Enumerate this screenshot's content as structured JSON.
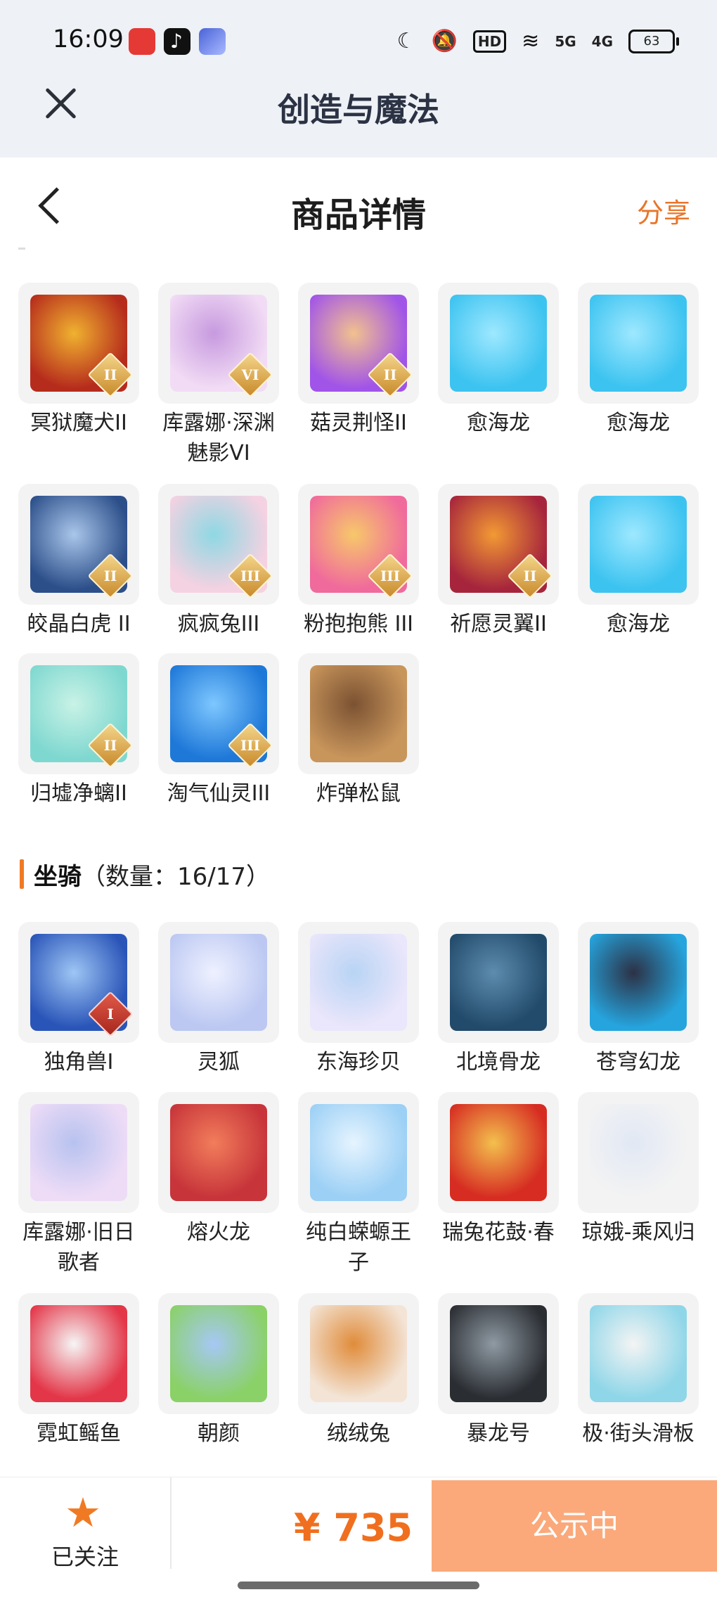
{
  "status_bar": {
    "time": "16:09",
    "hd_label": "HD",
    "network_1": "5G",
    "network_2": "4G",
    "battery": "63"
  },
  "app_bar": {
    "title": "创造与魔法"
  },
  "page_header": {
    "title": "商品详情",
    "share_label": "分享"
  },
  "pets": [
    {
      "label": "冥狱魔犬II",
      "badge": "II",
      "colors": [
        "#b62c1c",
        "#f0b230"
      ]
    },
    {
      "label": "库露娜·深渊魅影VI",
      "badge": "VI",
      "colors": [
        "#f2dcf5",
        "#c79adf"
      ]
    },
    {
      "label": "菇灵荆怪II",
      "badge": "II",
      "colors": [
        "#a154e8",
        "#f2c18e"
      ]
    },
    {
      "label": "愈海龙",
      "badge": "",
      "colors": [
        "#3cc3f0",
        "#9ee8ff"
      ]
    },
    {
      "label": "愈海龙",
      "badge": "",
      "colors": [
        "#3cc3f0",
        "#9ee8ff"
      ]
    },
    {
      "label": "皎晶白虎 II",
      "badge": "II",
      "colors": [
        "#2c4f8a",
        "#a9c6ea"
      ]
    },
    {
      "label": "疯疯兔III",
      "badge": "III",
      "colors": [
        "#f5d2e2",
        "#8ed8e3"
      ]
    },
    {
      "label": "粉抱抱熊 III",
      "badge": "III",
      "colors": [
        "#f06a9c",
        "#f7c86a"
      ]
    },
    {
      "label": "祈愿灵翼II",
      "badge": "II",
      "colors": [
        "#a6253c",
        "#f29a34"
      ]
    },
    {
      "label": "愈海龙",
      "badge": "",
      "colors": [
        "#3cc3f0",
        "#9ee8ff"
      ]
    },
    {
      "label": "归墟净螭II",
      "badge": "II",
      "colors": [
        "#7fd8d0",
        "#c9f2e6"
      ]
    },
    {
      "label": "淘气仙灵III",
      "badge": "III",
      "colors": [
        "#1e78d8",
        "#7ec7ff"
      ]
    },
    {
      "label": "炸弹松鼠",
      "badge": "",
      "colors": [
        "#c8955b",
        "#7b5232"
      ]
    }
  ],
  "mounts_section": {
    "title": "坐骑",
    "count": "（数量：16/17）"
  },
  "mounts": [
    {
      "label": "独角兽I",
      "badge": "I",
      "colors": [
        "#2a55b8",
        "#9ec6f5"
      ]
    },
    {
      "label": "灵狐",
      "badge": "",
      "colors": [
        "#bcc8f2",
        "#eef1ff"
      ]
    },
    {
      "label": "东海珍贝",
      "badge": "",
      "colors": [
        "#eae6fb",
        "#b8d4f4"
      ]
    },
    {
      "label": "北境骨龙",
      "badge": "",
      "colors": [
        "#224a6a",
        "#5d8cae"
      ]
    },
    {
      "label": "苍穹幻龙",
      "badge": "",
      "colors": [
        "#26a4dd",
        "#2c3145"
      ]
    },
    {
      "label": "库露娜·旧日歌者",
      "badge": "",
      "colors": [
        "#eedcf7",
        "#b7c2ef"
      ]
    },
    {
      "label": "熔火龙",
      "badge": "",
      "colors": [
        "#c7343a",
        "#f27d5b"
      ]
    },
    {
      "label": "纯白蝾螈王子",
      "badge": "",
      "colors": [
        "#9cd0f5",
        "#e6f4ff"
      ]
    },
    {
      "label": "瑞兔花鼓·春",
      "badge": "",
      "colors": [
        "#d62c22",
        "#f3c04d"
      ]
    },
    {
      "label": "琼娥-乘风归",
      "badge": "",
      "colors": [
        "#f3f3f3",
        "#e1e8f4"
      ]
    },
    {
      "label": "霓虹鳐鱼",
      "badge": "",
      "colors": [
        "#e33648",
        "#f6f6f6"
      ]
    },
    {
      "label": "朝颜",
      "badge": "",
      "colors": [
        "#8ad168",
        "#a6c8f5"
      ]
    },
    {
      "label": "绒绒兔",
      "badge": "",
      "colors": [
        "#f3e4d6",
        "#e08c3a"
      ]
    },
    {
      "label": "暴龙号",
      "badge": "",
      "colors": [
        "#2a2d32",
        "#8f9aa3"
      ]
    },
    {
      "label": "极·街头滑板",
      "badge": "",
      "colors": [
        "#8fd6e8",
        "#f4f4f4"
      ]
    }
  ],
  "bottom_bar": {
    "follow_label": "已关注",
    "price": "¥ 735",
    "action_label": "公示中"
  }
}
